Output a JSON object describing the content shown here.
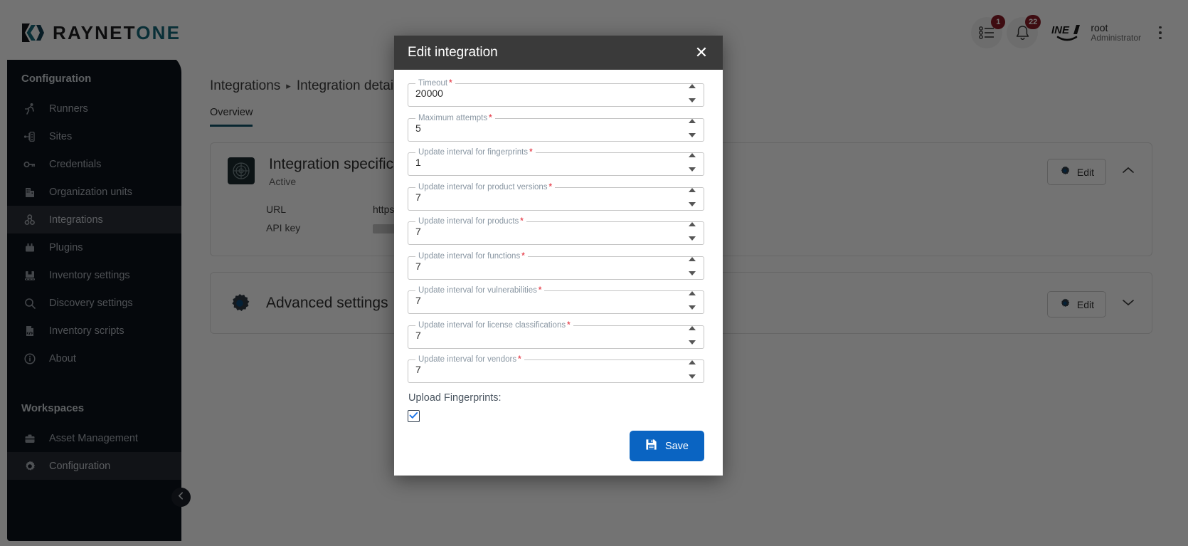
{
  "brand": {
    "name_plain": "RAYNET",
    "name_accent": "ONE",
    "logo_icon": "raynet-logo-icon"
  },
  "topbar": {
    "tasks": {
      "icon": "task-list-icon",
      "badge": "1"
    },
    "notifications": {
      "icon": "bell-icon",
      "badge": "22"
    },
    "user": {
      "name": "root",
      "role": "Administrator",
      "avatar_icon": "inet-avatar-icon"
    },
    "menu_icon": "kebab-menu-icon"
  },
  "sidebar": {
    "groups": [
      {
        "title": "Configuration",
        "items": [
          {
            "label": "Runners",
            "icon": "runner-icon",
            "active": false
          },
          {
            "label": "Sites",
            "icon": "sitemap-icon",
            "active": false
          },
          {
            "label": "Credentials",
            "icon": "key-icon",
            "active": false
          },
          {
            "label": "Organization units",
            "icon": "building-icon",
            "active": false
          },
          {
            "label": "Integrations",
            "icon": "integrations-icon",
            "active": true
          },
          {
            "label": "Plugins",
            "icon": "plugin-icon",
            "active": false
          },
          {
            "label": "Inventory settings",
            "icon": "inventory-icon",
            "active": false
          },
          {
            "label": "Discovery settings",
            "icon": "search-icon",
            "active": false
          },
          {
            "label": "Inventory scripts",
            "icon": "script-file-icon",
            "active": false
          },
          {
            "label": "About",
            "icon": "info-icon",
            "active": false
          }
        ]
      },
      {
        "title": "Workspaces",
        "items": [
          {
            "label": "Asset Management",
            "icon": "briefcase-icon",
            "active": false
          },
          {
            "label": "Configuration",
            "icon": "gear-icon",
            "active": true
          }
        ]
      }
    ],
    "collapse_icon": "chevron-left-icon"
  },
  "main": {
    "breadcrumb": {
      "root": "Integrations",
      "separator": "▸",
      "current": "Integration details"
    },
    "tabs": [
      {
        "label": "Overview",
        "active": true
      }
    ],
    "cards": [
      {
        "title": "Integration specification",
        "status": "Active",
        "icon": "radar-thumb-icon",
        "edit_label": "Edit",
        "edit_icon": "gear-icon",
        "toggle_icon": "chevron-up-icon",
        "rows": [
          {
            "key": "URL",
            "value": "https://"
          },
          {
            "key": "API key",
            "value": ""
          }
        ]
      },
      {
        "title": "Advanced settings",
        "icon": "gear-icon",
        "edit_label": "Edit",
        "edit_icon": "gear-icon",
        "toggle_icon": "chevron-down-icon"
      }
    ]
  },
  "modal": {
    "title": "Edit integration",
    "close_icon": "close-icon",
    "required_marker": "*",
    "fields": [
      {
        "label": "Timeout",
        "value": "20000",
        "required": true
      },
      {
        "label": "Maximum attempts",
        "value": "5",
        "required": true
      },
      {
        "label": "Update interval for fingerprints",
        "value": "1",
        "required": true
      },
      {
        "label": "Update interval for product versions",
        "value": "7",
        "required": true
      },
      {
        "label": "Update interval for products",
        "value": "7",
        "required": true
      },
      {
        "label": "Update interval for functions",
        "value": "7",
        "required": true
      },
      {
        "label": "Update interval for vulnerabilities",
        "value": "7",
        "required": true
      },
      {
        "label": "Update interval for license classifications",
        "value": "7",
        "required": true
      },
      {
        "label": "Update interval for vendors",
        "value": "7",
        "required": true
      }
    ],
    "checkbox": {
      "label": "Upload Fingerprints:",
      "checked": true,
      "icon": "checkmark-icon"
    },
    "save": {
      "label": "Save",
      "icon": "floppy-save-icon"
    }
  },
  "colors": {
    "brand_accent": "#14687a",
    "primary_button": "#0a64c2",
    "badge_red": "#8b1c26",
    "sidebar_bg": "#0d131c",
    "modal_header": "#3a3a3a",
    "required_red": "#e8505b",
    "tab_underline": "#13566b"
  }
}
